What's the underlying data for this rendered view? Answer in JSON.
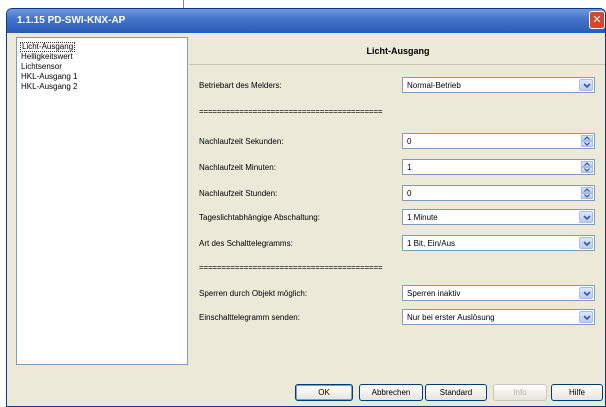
{
  "window": {
    "title": "1.1.15 PD-SWI-KNX-AP",
    "close_glyph": "✕"
  },
  "sidebar": {
    "items": [
      {
        "label": "Licht-Ausgang",
        "selected": true
      },
      {
        "label": "Helligkeitswert"
      },
      {
        "label": "Lichtsensor"
      },
      {
        "label": "HKL-Ausgang 1"
      },
      {
        "label": "HKL-Ausgang 2"
      }
    ]
  },
  "panel": {
    "title": "Licht-Ausgang",
    "separator": "=========================================",
    "params": {
      "betriebsart": {
        "label": "Betriebart des Melders:",
        "value": "Normal-Betrieb",
        "control": "dropdown"
      },
      "nachlauf_sek": {
        "label": "Nachlaufzeit Sekunden:",
        "value": "0",
        "control": "spinner"
      },
      "nachlauf_min": {
        "label": "Nachlaufzeit Minuten:",
        "value": "1",
        "control": "spinner"
      },
      "nachlauf_std": {
        "label": "Nachlaufzeit Stunden:",
        "value": "0",
        "control": "spinner"
      },
      "tageslicht": {
        "label": "Tageslichtabhängige Abschaltung:",
        "value": "1 Minute",
        "control": "dropdown"
      },
      "schalttelegramm": {
        "label": "Art des Schalttelegramms:",
        "value": "1 Bit, Ein/Aus",
        "control": "dropdown"
      },
      "sperren": {
        "label": "Sperren durch Objekt möglich:",
        "value": "Sperren inaktiv",
        "control": "dropdown"
      },
      "einschalt": {
        "label": "Einschalttelegramm senden:",
        "value": "Nur bei erster Auslösung",
        "control": "dropdown"
      }
    }
  },
  "buttons": {
    "ok": "OK",
    "abbrechen": "Abbrechen",
    "standard": "Standard",
    "info": "Info",
    "hilfe": "Hilfe"
  },
  "icons": {
    "dropdown": "chevron-down-icon",
    "spinner_up": "spin-up-icon",
    "spinner_down": "spin-down-icon",
    "close": "close-icon"
  },
  "colors": {
    "titlebar": "#3f72c8",
    "dialog_bg": "#ece9d8",
    "field_border": "#7f9db9",
    "close": "#d9472b"
  }
}
